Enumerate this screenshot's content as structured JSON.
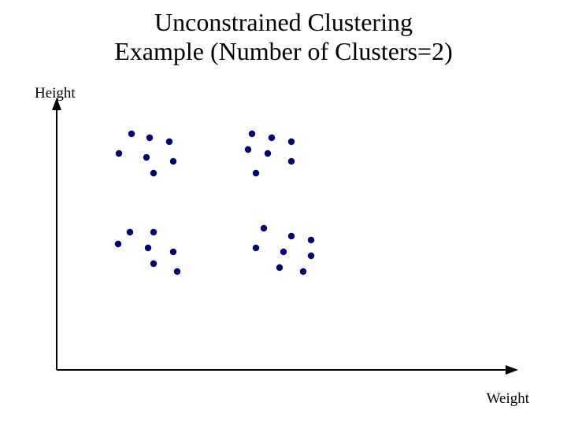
{
  "title_line1": "Unconstrained Clustering",
  "title_line2": "Example (Number of Clusters=2)",
  "ylabel": "Height",
  "xlabel": "Weight",
  "chart_data": {
    "type": "scatter",
    "title": "Unconstrained Clustering Example (Number of Clusters=2)",
    "xlabel": "Weight",
    "ylabel": "Height",
    "xlim": [
      0,
      600
    ],
    "ylim": [
      0,
      350
    ],
    "series": [
      {
        "name": "points",
        "color": "#00006e",
        "x": [
          107,
          130,
          155,
          91,
          126,
          160,
          135,
          260,
          285,
          310,
          255,
          280,
          310,
          265,
          105,
          135,
          90,
          128,
          160,
          135,
          165,
          275,
          310,
          335,
          265,
          300,
          335,
          295,
          325
        ],
        "y": [
          310,
          305,
          300,
          285,
          280,
          275,
          260,
          310,
          305,
          300,
          290,
          285,
          275,
          260,
          185,
          185,
          170,
          165,
          160,
          145,
          135,
          190,
          180,
          175,
          165,
          160,
          155,
          140,
          135
        ]
      }
    ]
  }
}
